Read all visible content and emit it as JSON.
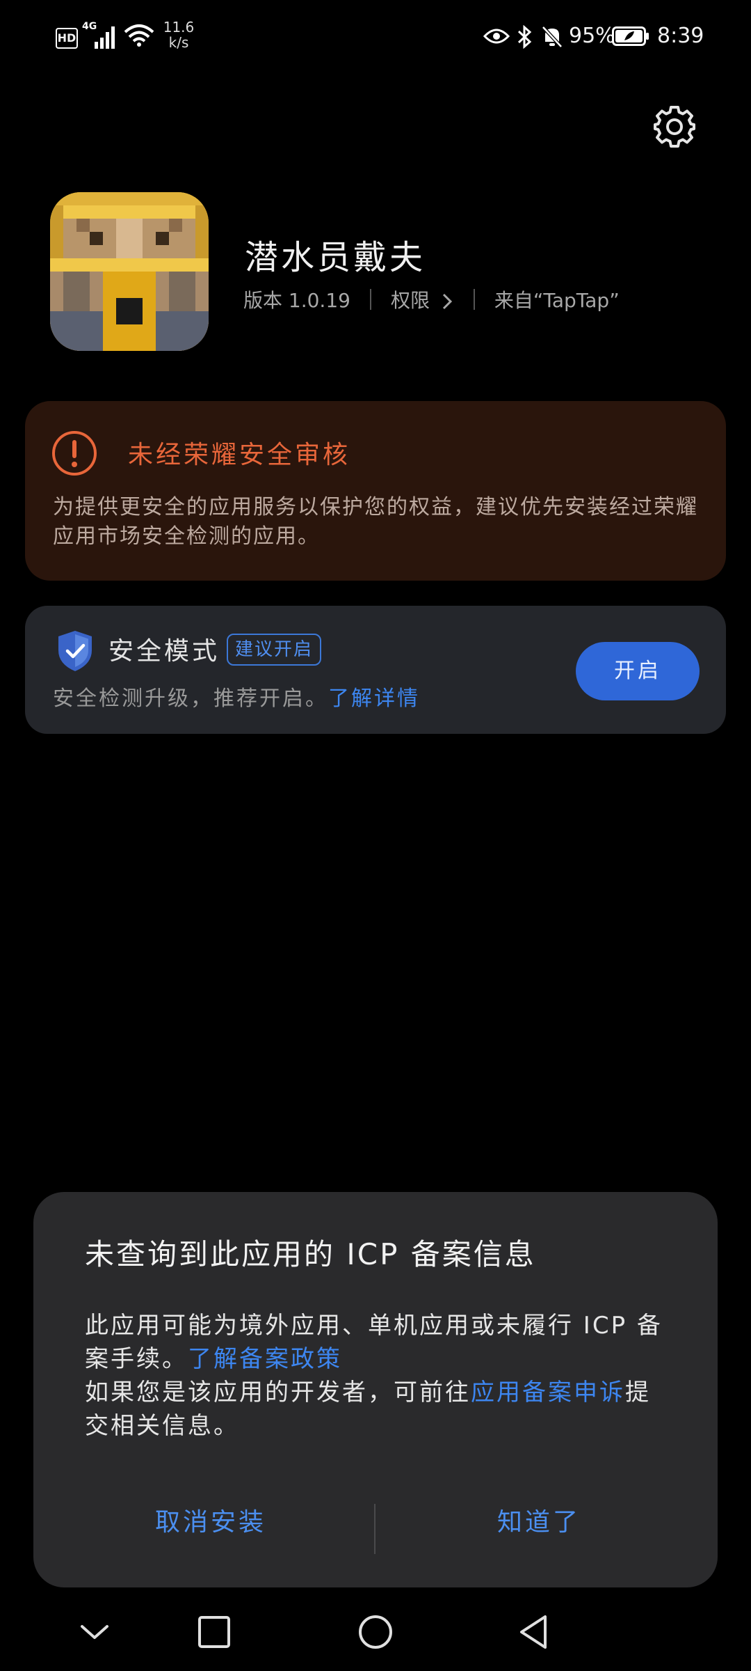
{
  "status_bar": {
    "hd": "HD",
    "network": "4G",
    "speed_value": "11.6",
    "speed_unit": "k/s",
    "battery_percent": "95%",
    "time": "8:39"
  },
  "app": {
    "name": "潜水员戴夫",
    "version": "版本 1.0.19",
    "permissions": "权限",
    "source": "来自“TapTap”"
  },
  "warning": {
    "title": "未经荣耀安全审核",
    "body": "为提供更安全的应用服务以保护您的权益，建议优先安装经过荣耀应用市场安全检测的应用。",
    "color": "#e8663a"
  },
  "safe_mode": {
    "title": "安全模式",
    "badge": "建议开启",
    "desc": "安全检测升级，推荐开启。",
    "link": "了解详情",
    "button": "开启",
    "accent": "#2f67d8"
  },
  "dialog": {
    "title": "未查询到此应用的 ICP 备案信息",
    "line1": "此应用可能为境外应用、单机应用或未履行 ICP 备案手续。",
    "link1": "了解备案政策",
    "line2": "如果您是该应用的开发者，可前往",
    "link2": "应用备案申诉",
    "line2_end": "提交相关信息。",
    "cancel": "取消安装",
    "ok": "知道了"
  }
}
